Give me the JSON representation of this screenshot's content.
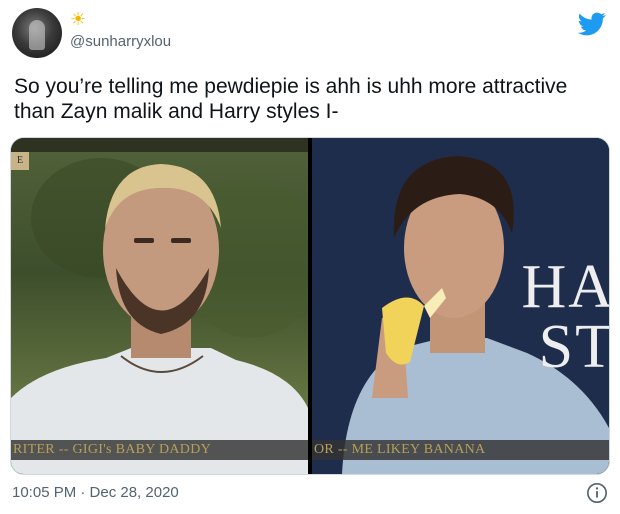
{
  "tweet": {
    "handle": "@sunharryxlou",
    "emoji": "☀",
    "text": "So you’re telling me pewdiepie is ahh is uhh more attractive than Zayn malik and Harry styles I-",
    "timestamp": "10:05 PM · Dec 28, 2020"
  },
  "media": {
    "left": {
      "corner_tag": "E",
      "caption": "RITER -- GIGI's BABY DADDY"
    },
    "right": {
      "overlay_text_1": "HA",
      "overlay_text_2": "ST",
      "caption": "OR -- ME LIKEY BANANA"
    }
  },
  "icons": {
    "brand": "twitter-bird-icon",
    "info": "info-icon"
  },
  "colors": {
    "twitter_blue": "#1d9bf0",
    "caption_gold": "#b79f5a",
    "secondary_text": "#536471"
  }
}
